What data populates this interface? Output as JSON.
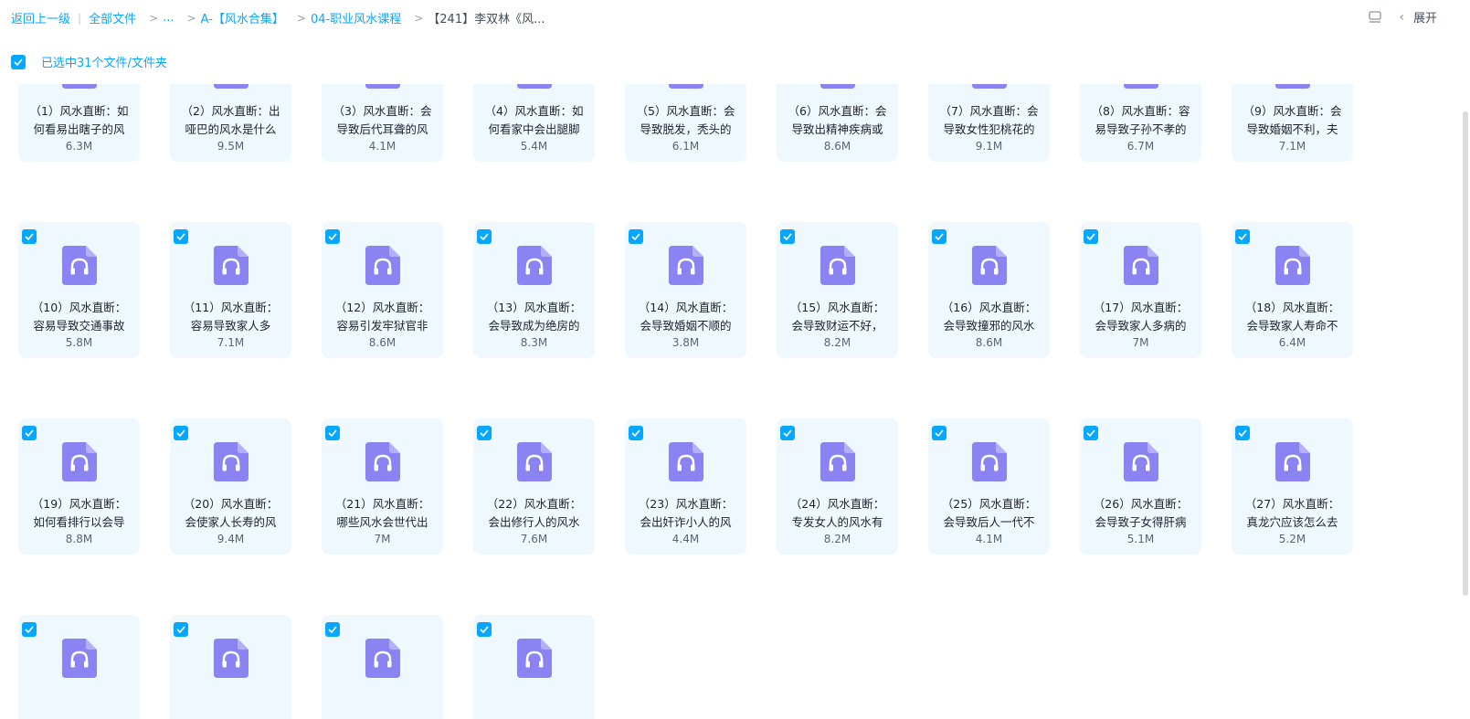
{
  "breadcrumb": {
    "back": "返回上一级",
    "all": "全部文件",
    "ellipsis": "...",
    "level1": "A-【风水合集】",
    "level2": "04-职业风水课程",
    "current": "【241】李双林《风..."
  },
  "toolbar": {
    "expand_label": "展开"
  },
  "selection": {
    "text": "已选中31个文件/文件夹"
  },
  "accent_color": "#06a7ff",
  "file_icon": "audio-file-icon",
  "files": [
    {
      "line1": "（1）风水直断：如",
      "line2": "何看易出瞎子的风",
      "size": "6.3M",
      "checked": false
    },
    {
      "line1": "（2）风水直断：出",
      "line2": "哑巴的风水是什么",
      "size": "9.5M",
      "checked": false
    },
    {
      "line1": "（3）风水直断：会",
      "line2": "导致后代耳聋的风",
      "size": "4.1M",
      "checked": false
    },
    {
      "line1": "（4）风水直断：如",
      "line2": "何看家中会出腿脚",
      "size": "5.4M",
      "checked": false
    },
    {
      "line1": "（5）风水直断：会",
      "line2": "导致脱发，秃头的",
      "size": "6.1M",
      "checked": false
    },
    {
      "line1": "（6）风水直断：会",
      "line2": "导致出精神疾病或",
      "size": "8.6M",
      "checked": false
    },
    {
      "line1": "（7）风水直断：会",
      "line2": "导致女性犯桃花的",
      "size": "9.1M",
      "checked": false
    },
    {
      "line1": "（8）风水直断：容",
      "line2": "易导致子孙不孝的",
      "size": "6.7M",
      "checked": false
    },
    {
      "line1": "（9）风水直断：会",
      "line2": "导致婚姻不利，夫",
      "size": "7.1M",
      "checked": false
    },
    {
      "line1": "（10）风水直断：",
      "line2": "容易导致交通事故",
      "size": "5.8M",
      "checked": true
    },
    {
      "line1": "（11）风水直断：",
      "line2": "容易导致家人多",
      "size": "7.1M",
      "checked": true
    },
    {
      "line1": "（12）风水直断：",
      "line2": "容易引发牢狱官非",
      "size": "8.6M",
      "checked": true
    },
    {
      "line1": "（13）风水直断：",
      "line2": "会导致成为绝房的",
      "size": "8.3M",
      "checked": true
    },
    {
      "line1": "（14）风水直断：",
      "line2": "会导致婚姻不顺的",
      "size": "3.8M",
      "checked": true
    },
    {
      "line1": "（15）风水直断：",
      "line2": "会导致财运不好，",
      "size": "8.2M",
      "checked": true
    },
    {
      "line1": "（16）风水直断：",
      "line2": "会导致撞邪的风水",
      "size": "8.6M",
      "checked": true
    },
    {
      "line1": "（17）风水直断：",
      "line2": "会导致家人多病的",
      "size": "7M",
      "checked": true
    },
    {
      "line1": "（18）风水直断：",
      "line2": "会导致家人寿命不",
      "size": "6.4M",
      "checked": true
    },
    {
      "line1": "（19）风水直断：",
      "line2": "如何看排行以会导",
      "size": "8.8M",
      "checked": true
    },
    {
      "line1": "（20）风水直断：",
      "line2": "会使家人长寿的风",
      "size": "9.4M",
      "checked": true
    },
    {
      "line1": "（21）风水直断：",
      "line2": "哪些风水会世代出",
      "size": "7M",
      "checked": true
    },
    {
      "line1": "（22）风水直断：",
      "line2": "会出修行人的风水",
      "size": "7.6M",
      "checked": true
    },
    {
      "line1": "（23）风水直断：",
      "line2": "会出奸诈小人的风",
      "size": "4.4M",
      "checked": true
    },
    {
      "line1": "（24）风水直断：",
      "line2": "专发女人的风水有",
      "size": "8.2M",
      "checked": true
    },
    {
      "line1": "（25）风水直断：",
      "line2": "会导致后人一代不",
      "size": "4.1M",
      "checked": true
    },
    {
      "line1": "（26）风水直断：",
      "line2": "会导致子女得肝病",
      "size": "5.1M",
      "checked": true
    },
    {
      "line1": "（27）风水直断：",
      "line2": "真龙穴应该怎么去",
      "size": "5.2M",
      "checked": true
    },
    {
      "line1": "",
      "line2": "",
      "size": "",
      "checked": true
    },
    {
      "line1": "",
      "line2": "",
      "size": "",
      "checked": true
    },
    {
      "line1": "",
      "line2": "",
      "size": "",
      "checked": true
    },
    {
      "line1": "",
      "line2": "",
      "size": "",
      "checked": true
    }
  ]
}
